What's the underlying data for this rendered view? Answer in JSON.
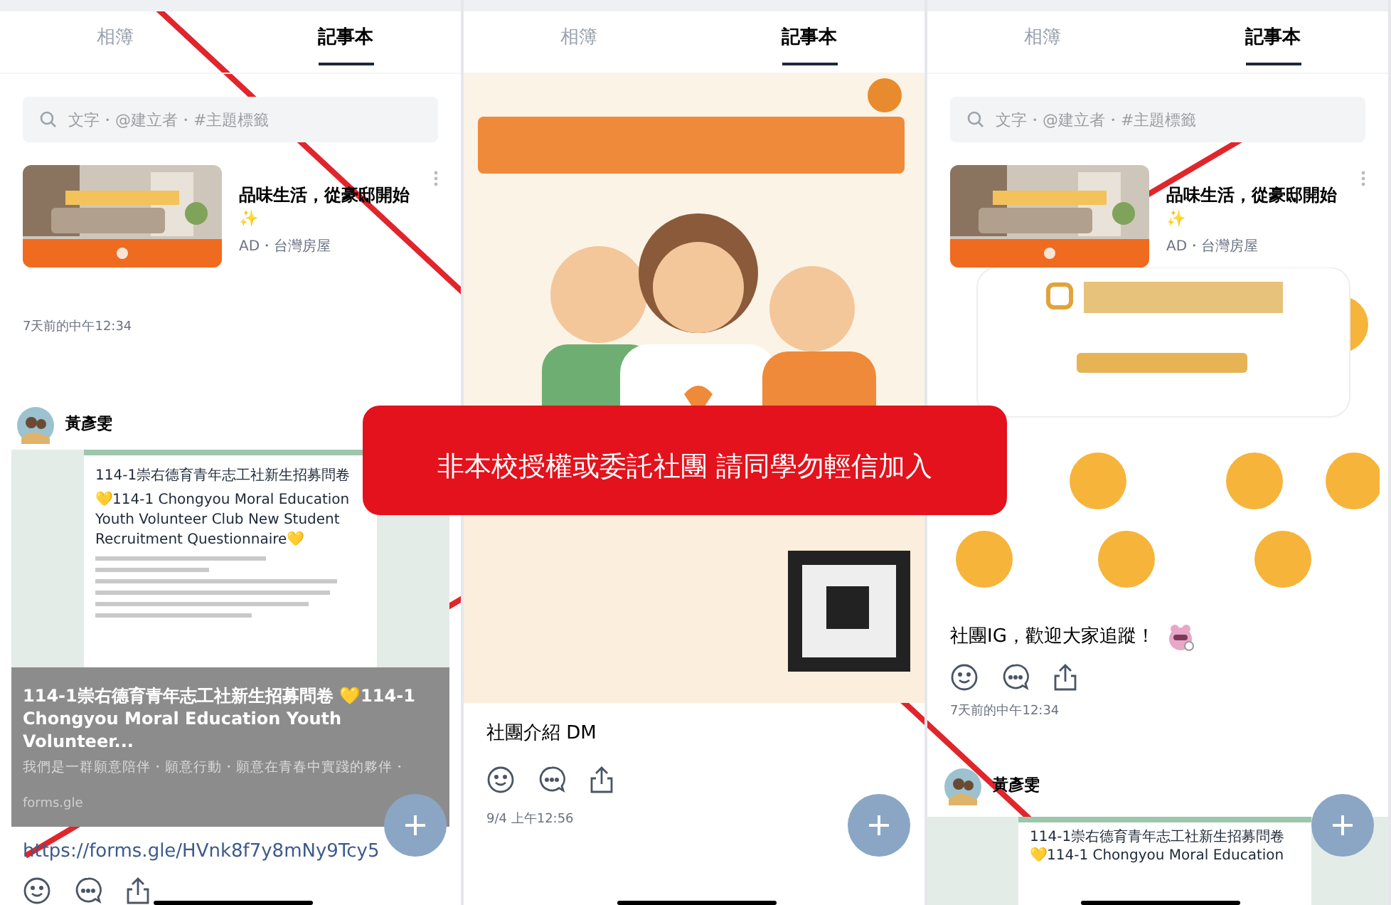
{
  "panels": [
    {
      "tabs": [
        {
          "label": "相簿",
          "selected": false
        },
        {
          "label": "記事本",
          "selected": true
        }
      ],
      "blocks": [
        {
          "kind": "search",
          "placeholder": "文字・@建立者・#主題標籤"
        },
        {
          "kind": "ad",
          "title": "品味生活，從豪邸開始",
          "emoji": "✨",
          "source": "AD・台灣房屋"
        },
        {
          "kind": "timestamp",
          "text": "7天前的中午12:34"
        },
        {
          "kind": "author",
          "name": "黃彥雯"
        },
        {
          "kind": "link_preview",
          "form_title": "114-1崇右德育青年志工社新生招募問卷",
          "form_subtitle": "💛114-1 Chongyou Moral Education Youth Volunteer Club New Student Recruitment Questionnaire💛",
          "title": "114-1崇右德育青年志工社新生招募問卷 💛114-1 Chongyou Moral Education Youth Volunteer...",
          "description": "我們是一群願意陪伴・願意行動・願意在青春中實踐的夥伴・",
          "domain": "forms.gle"
        },
        {
          "kind": "link",
          "text": "https://forms.gle/HVnk8f7y8mNy9Tcy5"
        },
        {
          "kind": "actions"
        }
      ]
    },
    {
      "tabs": [
        {
          "label": "相簿",
          "selected": false
        },
        {
          "label": "記事本",
          "selected": true
        }
      ],
      "blocks": [
        {
          "kind": "poster"
        },
        {
          "kind": "caption",
          "text": "社團介紹 DM"
        },
        {
          "kind": "actions"
        },
        {
          "kind": "timestamp",
          "text": "9/4 上午12:56"
        }
      ]
    },
    {
      "tabs": [
        {
          "label": "相簿",
          "selected": false
        },
        {
          "label": "記事本",
          "selected": true
        }
      ],
      "blocks": [
        {
          "kind": "search",
          "placeholder": "文字・@建立者・#主題標籤"
        },
        {
          "kind": "ad",
          "title": "品味生活，從豪邸開始",
          "emoji": "✨",
          "source": "AD・台灣房屋"
        },
        {
          "kind": "ig_picture"
        },
        {
          "kind": "caption",
          "text": "社團IG，歡迎大家追蹤！",
          "sticker": true
        },
        {
          "kind": "actions"
        },
        {
          "kind": "timestamp",
          "text": "7天前的中午12:34"
        },
        {
          "kind": "author",
          "name": "黃彥雯"
        },
        {
          "kind": "form_peek",
          "form_title": "114-1崇右德育青年志工社新生招募問卷",
          "form_subtitle": "💛114-1 Chongyou Moral Education"
        }
      ]
    }
  ],
  "warning": {
    "text": "非本校授權或委託社團 請同學勿輕信加入"
  }
}
